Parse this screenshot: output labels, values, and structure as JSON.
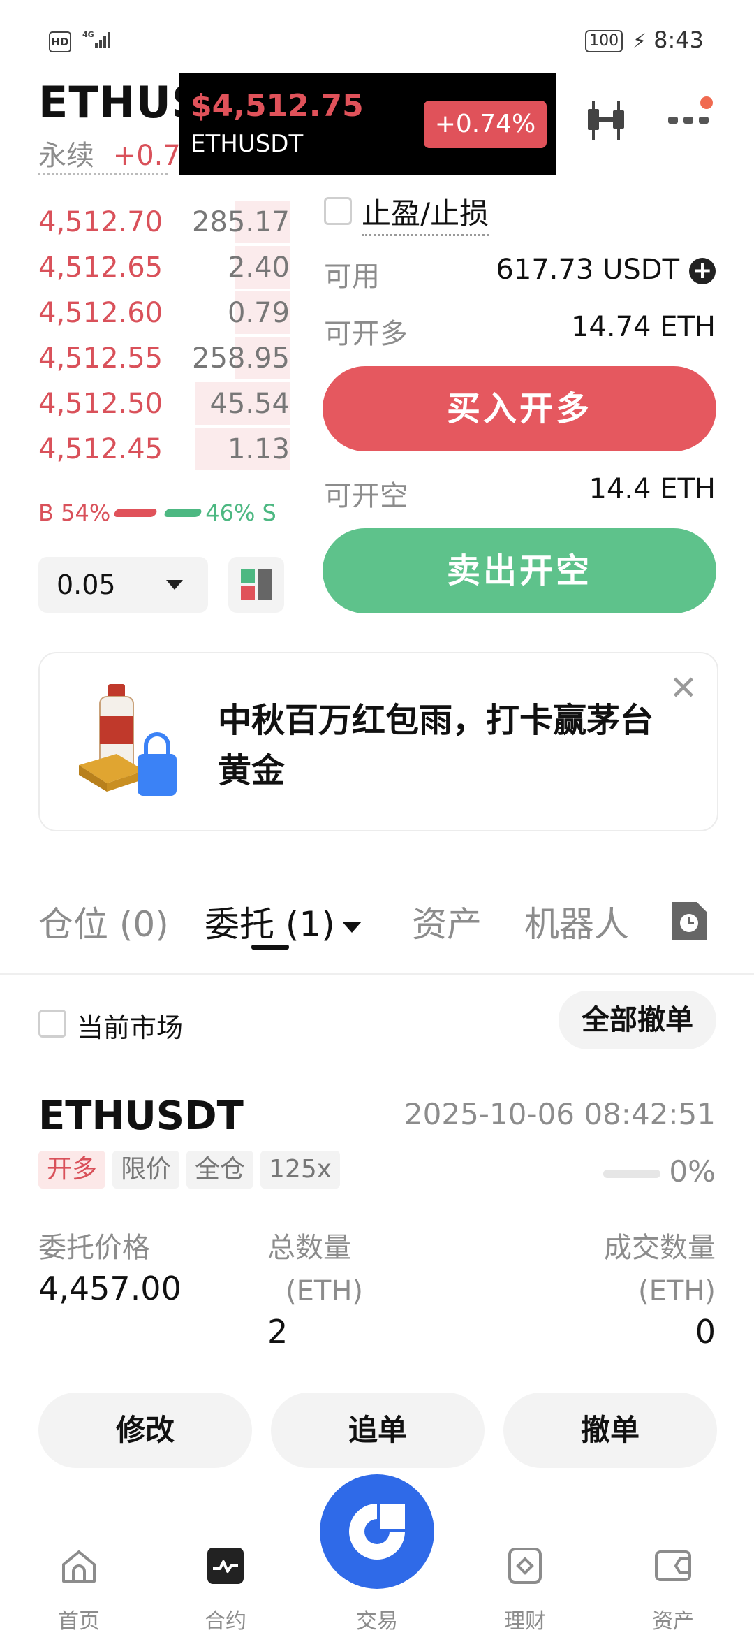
{
  "status_bar": {
    "hd": "HD",
    "network": "4G",
    "battery": "100",
    "time": "8:43"
  },
  "header": {
    "symbol": "ETHUS",
    "subtitle": "永续",
    "change_partial": "+0.7",
    "ticker": {
      "price": "$4,512.75",
      "symbol": "ETHUSDT",
      "change": "+0.74%"
    }
  },
  "orderbook": {
    "asks": [
      {
        "price": "4,512.70",
        "qty": "285.17",
        "depth": 0.28
      },
      {
        "price": "4,512.65",
        "qty": "2.40",
        "depth": 0.28
      },
      {
        "price": "4,512.60",
        "qty": "0.79",
        "depth": 0.28
      },
      {
        "price": "4,512.55",
        "qty": "258.95",
        "depth": 0.28
      },
      {
        "price": "4,512.50",
        "qty": "45.54",
        "depth": 0.34
      },
      {
        "price": "4,512.45",
        "qty": "1.13",
        "depth": 0.34
      }
    ],
    "buy_ratio": "B 54%",
    "sell_ratio": "46% S",
    "amount": "0.05"
  },
  "form": {
    "tpsl_label": "止盈/止损",
    "available_label": "可用",
    "available_value": "617.73 USDT",
    "can_long_label": "可开多",
    "can_long_value": "14.74 ETH",
    "buy_button": "买入开多",
    "can_short_label": "可开空",
    "can_short_value": "14.4 ETH",
    "sell_button": "卖出开空"
  },
  "banner": {
    "text": "中秋百万红包雨，打卡赢茅台黄金"
  },
  "tabs": [
    {
      "label": "仓位 (0)"
    },
    {
      "label": "委托 (1)"
    },
    {
      "label": "资产"
    },
    {
      "label": "机器人"
    }
  ],
  "filter": {
    "current_market": "当前市场",
    "cancel_all": "全部撤单"
  },
  "order": {
    "symbol": "ETHUSDT",
    "time": "2025-10-06 08:42:51",
    "tags": [
      "开多",
      "限价",
      "全仓",
      "125x"
    ],
    "progress": "0%",
    "price_label": "委托价格",
    "price_value": "4,457.00",
    "total_label": "总数量",
    "total_unit": "(ETH)",
    "total_value": "2",
    "filled_label": "成交数量",
    "filled_unit": "(ETH)",
    "filled_value": "0",
    "actions": {
      "modify": "修改",
      "chase": "追单",
      "cancel": "撤单"
    }
  },
  "nav": {
    "home": "首页",
    "futures": "合约",
    "trade": "交易",
    "earn": "理财",
    "assets": "资产"
  },
  "colors": {
    "red": "#d9515a",
    "green": "#4db882",
    "blue": "#2f6ae8"
  }
}
